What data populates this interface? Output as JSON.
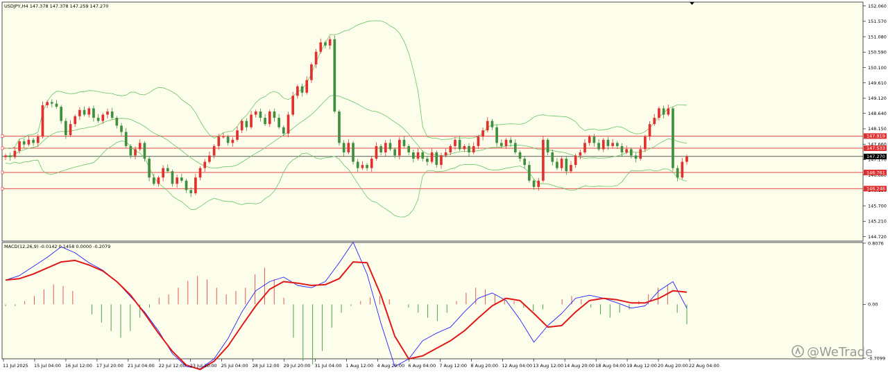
{
  "window": {
    "symbol_info": "USDJPY,H4  147.378 147.378 147.259 147.270",
    "indicator_info": "MACD(12,26,9) -0.0142 0.1458 0.0000 -0.2079",
    "watermark": "@WeTrade"
  },
  "colors": {
    "background": "#fdfdeb",
    "bull": "#e0312e",
    "bear": "#3f8f3f",
    "bands": "#66c466",
    "level_line": "#e03030",
    "price_line": "#000000",
    "macd_line": "#2222ff",
    "signal_line": "#e01818",
    "hist_pos": "#e05a50",
    "hist_neg": "#4ca24c"
  },
  "chart_data": [
    {
      "type": "candlestick",
      "title": "USDJPY,H4",
      "ohlc_header": {
        "open": 147.378,
        "high": 147.378,
        "low": 147.259,
        "close": 147.27
      },
      "ylim": [
        144.6,
        152.16
      ],
      "y_ticks": [
        "152.060",
        "151.570",
        "151.080",
        "150.590",
        "150.100",
        "149.610",
        "149.120",
        "148.640",
        "148.150",
        "147.660",
        "147.170",
        "146.680",
        "146.190",
        "145.700",
        "145.210",
        "144.720"
      ],
      "x_ticks": [
        "11 Jul 2025",
        "15 Jul 04:00",
        "16 Jul 12:00",
        "17 Jul 20:00",
        "21 Jul 04:00",
        "22 Jul 12:00",
        "23 Jul 20:00",
        "25 Jul 04:00",
        "28 Jul 12:00",
        "29 Jul 20:00",
        "31 Jul 04:00",
        "1 Aug 12:00",
        "4 Aug 20:00",
        "6 Aug 04:00",
        "7 Aug 12:00",
        "8 Aug 20:00",
        "12 Aug 04:00",
        "13 Aug 12:00",
        "14 Aug 20:00",
        "18 Aug 04:00",
        "19 Aug 12:00",
        "20 Aug 20:00",
        "22 Aug 04:00"
      ],
      "levels": [
        {
          "label": "147.919",
          "value": 147.919
        },
        {
          "label": "147.533",
          "value": 147.533
        },
        {
          "label": "146.761",
          "value": 146.761
        },
        {
          "label": "146.246",
          "value": 146.246
        }
      ],
      "current_price": {
        "label": "147.270",
        "value": 147.27
      },
      "closes": [
        147.3,
        147.25,
        147.45,
        147.75,
        147.65,
        147.8,
        147.7,
        147.9,
        148.9,
        149.0,
        148.95,
        148.85,
        148.4,
        147.95,
        148.3,
        148.55,
        148.75,
        148.6,
        148.8,
        148.5,
        148.4,
        148.6,
        148.7,
        148.5,
        148.25,
        148.05,
        147.6,
        147.3,
        147.5,
        147.7,
        147.2,
        146.6,
        146.4,
        146.6,
        146.9,
        146.8,
        146.4,
        146.6,
        146.5,
        146.2,
        146.1,
        146.6,
        146.9,
        147.1,
        147.3,
        147.6,
        147.9,
        147.9,
        147.7,
        147.8,
        148.1,
        148.4,
        148.2,
        148.6,
        148.7,
        148.5,
        148.3,
        148.7,
        148.5,
        148.2,
        148.0,
        148.6,
        149.2,
        149.5,
        149.3,
        149.7,
        150.2,
        150.6,
        150.9,
        150.8,
        151.0,
        148.7,
        147.7,
        147.4,
        147.7,
        147.1,
        146.9,
        147.0,
        146.9,
        147.2,
        147.6,
        147.4,
        147.7,
        147.5,
        147.3,
        147.8,
        147.6,
        147.4,
        147.2,
        147.4,
        147.2,
        147.1,
        147.4,
        147.0,
        147.3,
        147.4,
        147.6,
        147.8,
        147.5,
        147.6,
        147.4,
        147.6,
        147.9,
        148.1,
        148.4,
        148.2,
        147.7,
        147.6,
        147.8,
        147.7,
        147.4,
        147.2,
        147.0,
        146.5,
        146.3,
        146.5,
        147.8,
        147.4,
        147.1,
        146.9,
        147.2,
        146.8,
        147.0,
        147.3,
        147.4,
        147.7,
        147.9,
        147.7,
        147.5,
        147.8,
        147.6,
        147.7,
        147.6,
        147.4,
        147.5,
        147.3,
        147.2,
        147.5,
        147.9,
        148.3,
        148.5,
        148.8,
        148.6,
        148.8,
        146.9,
        146.6,
        147.1,
        147.27
      ],
      "bollinger": {
        "period": 20,
        "note": "upper, middle and lower bands drawn around the closes"
      }
    },
    {
      "type": "macd",
      "title": "MACD(12,26,9)",
      "values_header": {
        "macd": -0.0142,
        "signal": 0.1458,
        "v3": 0.0,
        "v4": -0.2079
      },
      "ylim": [
        -0.7099,
        0.8076
      ],
      "y_ticks": [
        "0.8076",
        "0.00",
        "-0.7099"
      ],
      "macd_points": [
        0.32,
        0.38,
        0.5,
        0.62,
        0.76,
        0.68,
        0.55,
        0.45,
        0.3,
        0.1,
        -0.1,
        -0.35,
        -0.65,
        -0.82,
        -0.85,
        -0.72,
        -0.45,
        -0.1,
        0.18,
        0.3,
        0.36,
        0.25,
        0.22,
        0.3,
        0.55,
        0.82,
        0.4,
        -0.25,
        -0.82,
        -0.72,
        -0.48,
        -0.38,
        -0.3,
        -0.1,
        0.08,
        0.15,
        0.05,
        -0.2,
        -0.5,
        -0.28,
        -0.12,
        0.08,
        0.12,
        0.08,
        0.02,
        -0.05,
        -0.02,
        0.18,
        0.3,
        -0.05
      ],
      "signal_points": [
        0.32,
        0.34,
        0.4,
        0.48,
        0.56,
        0.58,
        0.52,
        0.44,
        0.3,
        0.12,
        -0.12,
        -0.38,
        -0.62,
        -0.8,
        -0.86,
        -0.75,
        -0.55,
        -0.28,
        -0.02,
        0.2,
        0.3,
        0.28,
        0.25,
        0.26,
        0.34,
        0.56,
        0.55,
        0.12,
        -0.42,
        -0.72,
        -0.68,
        -0.58,
        -0.48,
        -0.35,
        -0.18,
        -0.02,
        0.08,
        0.05,
        -0.12,
        -0.3,
        -0.28,
        -0.1,
        0.05,
        0.08,
        0.06,
        0.02,
        0.02,
        0.08,
        0.18,
        0.16
      ],
      "histogram": [
        -0.01,
        -0.01,
        0.02,
        0.05,
        0.09,
        0.12,
        0.11,
        0.08,
        0.0,
        -0.06,
        -0.11,
        -0.16,
        -0.2,
        -0.16,
        -0.08,
        -0.02,
        0.04,
        0.06,
        0.1,
        0.14,
        0.17,
        0.15,
        0.1,
        0.06,
        0.08,
        0.1,
        0.18,
        0.22,
        0.15,
        0.04,
        -0.2,
        -0.34,
        -0.36,
        -0.28,
        -0.14,
        -0.05,
        -0.01,
        0.02,
        0.04,
        0.05,
        0.03,
        0.0,
        -0.02,
        -0.05,
        -0.08,
        -0.1,
        -0.05,
        0.02,
        0.07,
        0.1,
        0.09,
        0.06,
        0.04,
        0.02,
        -0.02,
        -0.04,
        -0.03,
        0.0,
        0.03,
        0.05,
        0.03,
        -0.02,
        -0.06,
        -0.08,
        -0.05,
        -0.03,
        0.02,
        0.06,
        0.1,
        0.12,
        -0.05,
        -0.12
      ]
    }
  ]
}
